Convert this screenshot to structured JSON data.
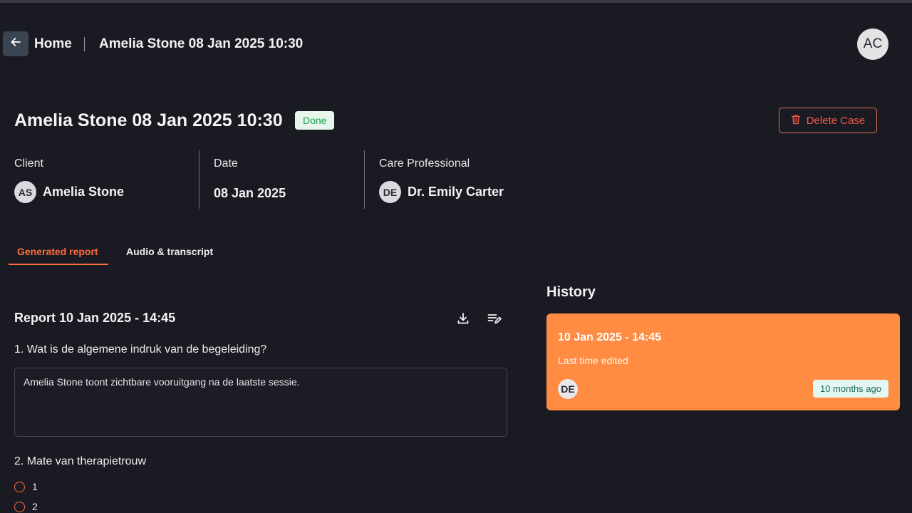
{
  "header": {
    "back_icon": "arrow-left-icon",
    "home_label": "Home",
    "breadcrumb_current": "Amelia Stone 08 Jan 2025 10:30",
    "user_initials": "AC"
  },
  "case": {
    "title": "Amelia Stone 08 Jan 2025 10:30",
    "status": "Done",
    "status_color": "#1f9d50",
    "delete_label": "Delete Case",
    "delete_icon": "trash-icon",
    "delete_color": "#ef5a4b"
  },
  "info": {
    "client_label": "Client",
    "client_initials": "AS",
    "client_name": "Amelia Stone",
    "date_label": "Date",
    "date_value": "08 Jan 2025",
    "professional_label": "Care Professional",
    "professional_initials": "DE",
    "professional_name": "Dr. Emily Carter"
  },
  "tabs": [
    {
      "label": "Generated report",
      "active": true
    },
    {
      "label": "Audio & transcript",
      "active": false
    }
  ],
  "accent_color": "#ff6b3d",
  "report": {
    "title": "Report 10 Jan 2025 - 14:45",
    "download_icon": "download-icon",
    "edit_icon": "edit-list-icon",
    "questions": [
      {
        "label": "1. Wat is de algemene indruk van de begeleiding?",
        "answer": "Amelia Stone toont zichtbare vooruitgang na de laatste sessie."
      },
      {
        "label": "2. Mate van therapietrouw",
        "options": [
          "1",
          "2"
        ]
      }
    ]
  },
  "history": {
    "title": "History",
    "card_color": "#ff8c42",
    "entries": [
      {
        "title": "10 Jan 2025 - 14:45",
        "subtitle": "Last time edited",
        "initials": "DE",
        "relative_time": "10 months ago"
      }
    ]
  }
}
